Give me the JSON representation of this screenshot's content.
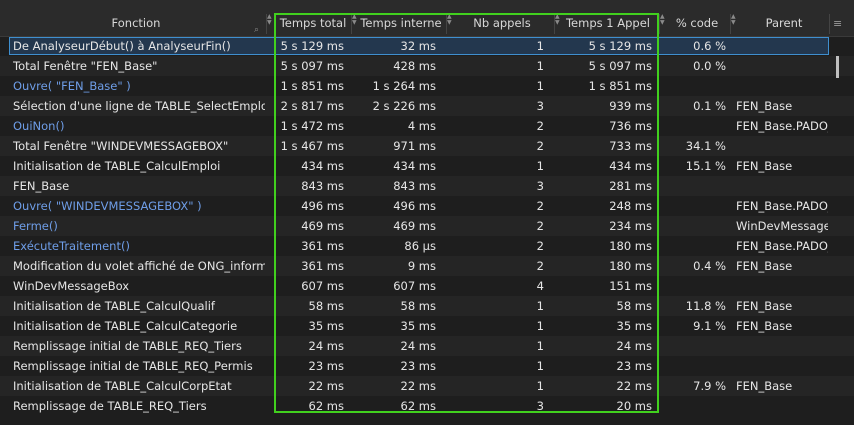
{
  "columns": {
    "fonction": "Fonction",
    "temps_total": "Temps total",
    "temps_interne": "Temps interne",
    "nb_appels": "Nb appels",
    "temps_1_appel": "Temps 1 Appel",
    "pct_code": "% code",
    "parent": "Parent"
  },
  "menu_icon": "≡",
  "search_icon": "⌕",
  "highlight_color": "#41d01e",
  "selection_color": "#3f8fcf",
  "rows": [
    {
      "fn": "De AnalyseurDébut() à AnalyseurFin()",
      "tt": "5 s 129 ms",
      "ti": "32 ms",
      "nb": "1",
      "t1": "5 s 129 ms",
      "pc": "0.6 %",
      "pa": "",
      "link": false,
      "selected": true
    },
    {
      "fn": "Total Fenêtre \"FEN_Base\"",
      "tt": "5 s 097 ms",
      "ti": "428 ms",
      "nb": "1",
      "t1": "5 s 097 ms",
      "pc": "0.0 %",
      "pa": "",
      "link": false
    },
    {
      "fn": "Ouvre( \"FEN_Base\" )",
      "tt": "1 s 851 ms",
      "ti": "1 s 264 ms",
      "nb": "1",
      "t1": "1 s 851 ms",
      "pc": "",
      "pa": "",
      "link": true
    },
    {
      "fn": "Sélection d'une ligne de TABLE_SelectEmploye",
      "tt": "2 s 817 ms",
      "ti": "2 s 226 ms",
      "nb": "3",
      "t1": "939 ms",
      "pc": "0.1 %",
      "pa": "FEN_Base",
      "link": false
    },
    {
      "fn": "OuiNon()",
      "tt": "1 s 472 ms",
      "ti": "4 ms",
      "nb": "2",
      "t1": "736 ms",
      "pc": "",
      "pa": "FEN_Base.PADO_",
      "link": true
    },
    {
      "fn": "Total Fenêtre \"WINDEVMESSAGEBOX\"",
      "tt": "1 s 467 ms",
      "ti": "971 ms",
      "nb": "2",
      "t1": "733 ms",
      "pc": "34.1 %",
      "pa": "",
      "link": false
    },
    {
      "fn": "Initialisation de TABLE_CalculEmploi",
      "tt": "434 ms",
      "ti": "434 ms",
      "nb": "1",
      "t1": "434 ms",
      "pc": "15.1 %",
      "pa": "FEN_Base",
      "link": false
    },
    {
      "fn": "FEN_Base",
      "tt": "843 ms",
      "ti": "843 ms",
      "nb": "3",
      "t1": "281 ms",
      "pc": "",
      "pa": "",
      "link": false
    },
    {
      "fn": "Ouvre( \"WINDEVMESSAGEBOX\" )",
      "tt": "496 ms",
      "ti": "496 ms",
      "nb": "2",
      "t1": "248 ms",
      "pc": "",
      "pa": "FEN_Base.PADO_",
      "link": true
    },
    {
      "fn": "Ferme()",
      "tt": "469 ms",
      "ti": "469 ms",
      "nb": "2",
      "t1": "234 ms",
      "pc": "",
      "pa": "WinDevMessageB",
      "link": true
    },
    {
      "fn": "ExécuteTraitement()",
      "tt": "361 ms",
      "ti": "86 µs",
      "nb": "2",
      "t1": "180 ms",
      "pc": "",
      "pa": "FEN_Base.PADO_",
      "link": true
    },
    {
      "fn": "Modification du volet affiché de ONG_informat",
      "tt": "361 ms",
      "ti": "9 ms",
      "nb": "2",
      "t1": "180 ms",
      "pc": "0.4 %",
      "pa": "FEN_Base",
      "link": false
    },
    {
      "fn": "WinDevMessageBox",
      "tt": "607 ms",
      "ti": "607 ms",
      "nb": "4",
      "t1": "151 ms",
      "pc": "",
      "pa": "",
      "link": false
    },
    {
      "fn": "Initialisation de TABLE_CalculQualif",
      "tt": "58 ms",
      "ti": "58 ms",
      "nb": "1",
      "t1": "58 ms",
      "pc": "11.8 %",
      "pa": "FEN_Base",
      "link": false
    },
    {
      "fn": "Initialisation de TABLE_CalculCategorie",
      "tt": "35 ms",
      "ti": "35 ms",
      "nb": "1",
      "t1": "35 ms",
      "pc": "9.1 %",
      "pa": "FEN_Base",
      "link": false
    },
    {
      "fn": "Remplissage initial de TABLE_REQ_Tiers",
      "tt": "24 ms",
      "ti": "24 ms",
      "nb": "1",
      "t1": "24 ms",
      "pc": "",
      "pa": "",
      "link": false
    },
    {
      "fn": "Remplissage initial de TABLE_REQ_Permis",
      "tt": "23 ms",
      "ti": "23 ms",
      "nb": "1",
      "t1": "23 ms",
      "pc": "",
      "pa": "",
      "link": false
    },
    {
      "fn": "Initialisation de TABLE_CalculCorpEtat",
      "tt": "22 ms",
      "ti": "22 ms",
      "nb": "1",
      "t1": "22 ms",
      "pc": "7.9 %",
      "pa": "FEN_Base",
      "link": false
    },
    {
      "fn": "Remplissage de TABLE_REQ_Tiers",
      "tt": "62 ms",
      "ti": "62 ms",
      "nb": "3",
      "t1": "20 ms",
      "pc": "",
      "pa": "",
      "link": false
    }
  ]
}
